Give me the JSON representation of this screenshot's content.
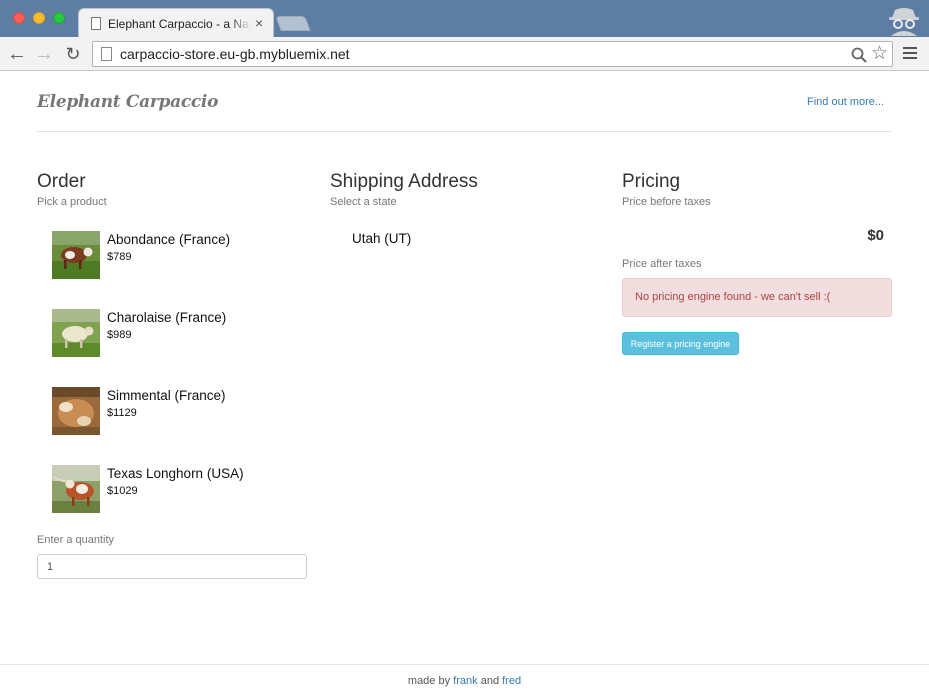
{
  "browser": {
    "tab_title": "Elephant Carpaccio - a Narrowing Exercise",
    "tab_close": "×",
    "url": "carpaccio-store.eu-gb.mybluemix.net",
    "icons": [
      "back-arrow-icon",
      "forward-arrow-icon",
      "reload-icon",
      "page-icon",
      "search-icon",
      "bookmark-star-icon",
      "menu-icon",
      "incognito-icon"
    ]
  },
  "header": {
    "brand": "Elephant Carpaccio",
    "find_out": "Find out more..."
  },
  "order": {
    "title": "Order",
    "subtitle": "Pick a product",
    "products": [
      {
        "name": "Abondance (France)",
        "price": "$789"
      },
      {
        "name": "Charolaise (France)",
        "price": "$989"
      },
      {
        "name": "Simmental (France)",
        "price": "$1129"
      },
      {
        "name": "Texas Longhorn (USA)",
        "price": "$1029"
      }
    ],
    "quantity_label": "Enter a quantity",
    "quantity_value": "1"
  },
  "shipping": {
    "title": "Shipping Address",
    "subtitle": "Select a state",
    "state": "Utah (UT)"
  },
  "pricing": {
    "title": "Pricing",
    "before_label": "Price before taxes",
    "before_value": "$0",
    "after_label": "Price after taxes",
    "alert": "No pricing engine found - we can't sell :(",
    "register_button": "Register a pricing engine"
  },
  "footer": {
    "prefix": "made by",
    "author1": "frank",
    "conjunction": "and",
    "author2": "fred"
  },
  "colors": {
    "link": "#337ab7",
    "alert_bg": "#f2dede",
    "alert_text": "#a94442",
    "button_info": "#5bc0de"
  }
}
